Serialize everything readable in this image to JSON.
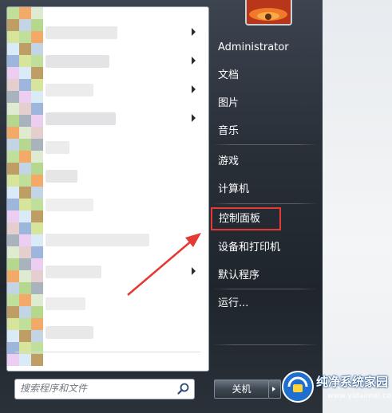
{
  "right_menu": {
    "user_name": "Administrator",
    "items": [
      {
        "label": "文档"
      },
      {
        "label": "图片"
      },
      {
        "label": "音乐"
      },
      {
        "label": "游戏"
      },
      {
        "label": "计算机"
      },
      {
        "label": "控制面板",
        "highlighted": true
      },
      {
        "label": "设备和打印机"
      },
      {
        "label": "默认程序"
      },
      {
        "label": "运行..."
      }
    ]
  },
  "search": {
    "placeholder": "搜索程序和文件"
  },
  "shutdown": {
    "label": "关机"
  },
  "watermark": {
    "title": "纯净系统家园",
    "url": "www.yidaimei.com"
  },
  "colors": {
    "highlight_box": "#e53a33",
    "annotation_arrow": "#e53a33",
    "menu_text": "#ffffff"
  },
  "icons": {
    "search": "magnifier-icon",
    "submenu": "chevron-right-icon",
    "avatar": "flower-avatar"
  }
}
